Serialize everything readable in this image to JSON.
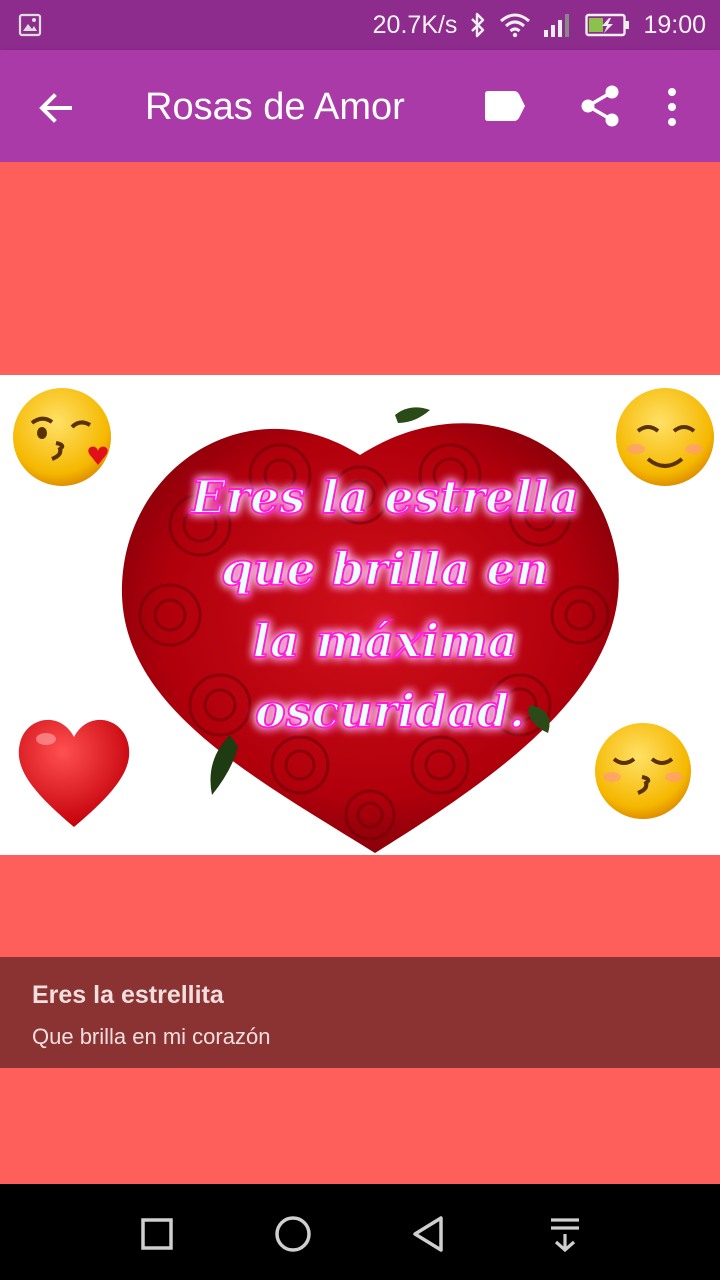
{
  "status_bar": {
    "network_speed": "20.7K/s",
    "time": "19:00",
    "icons": [
      "image-notification-icon",
      "bluetooth-icon",
      "wifi-icon",
      "signal-icon",
      "battery-charging-icon"
    ]
  },
  "app_bar": {
    "title": "Rosas de Amor",
    "icons": [
      "back-arrow-icon",
      "label-icon",
      "share-icon",
      "more-vert-icon"
    ]
  },
  "image": {
    "overlay_text": [
      "Eres la estrella",
      "que brilla en",
      "la máxima",
      "oscuridad."
    ],
    "decorations": [
      "kissing-heart-emoji",
      "smiling-blush-emoji",
      "red-heart-emoji",
      "kissing-closed-eyes-emoji",
      "rose-heart-bouquet"
    ]
  },
  "caption": {
    "title": "Eres la estrellita",
    "subtitle": "Que brilla en mi corazón"
  },
  "nav_bar": {
    "icons": [
      "recents-square-icon",
      "home-circle-icon",
      "back-triangle-icon",
      "notification-pull-icon"
    ]
  },
  "colors": {
    "status_bar": "#8e2c8e",
    "app_bar": "#ab3aa9",
    "background": "#ff5f5a",
    "caption_bg": "#8b3333"
  }
}
